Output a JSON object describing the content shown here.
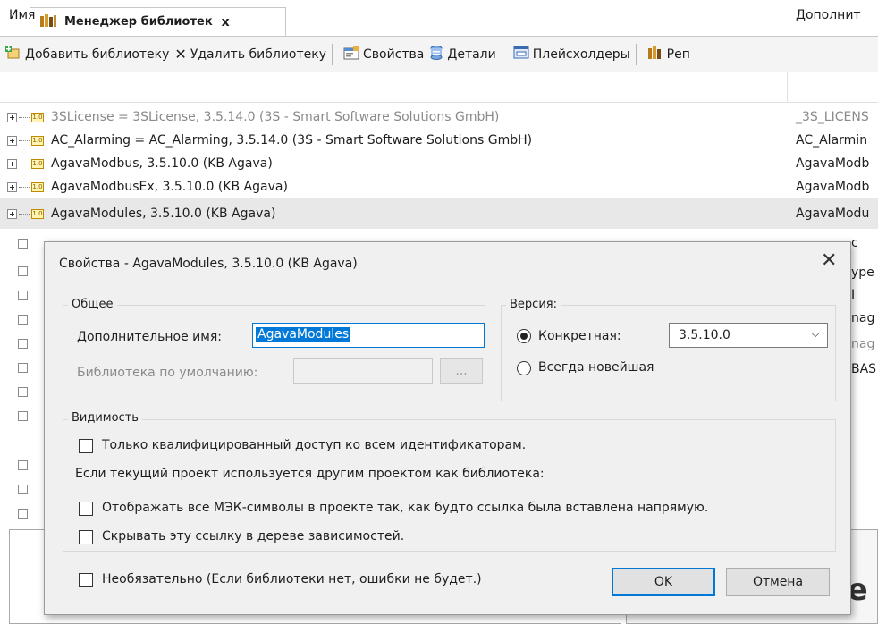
{
  "tab": {
    "title": "Менеджер библиотек",
    "close": "x"
  },
  "toolbar": {
    "add": "Добавить библиотеку",
    "delete": "Удалить библиотеку",
    "properties": "Свойства",
    "details": "Детали",
    "placeholders": "Плейсхолдеры",
    "repo": "Реп"
  },
  "list": {
    "col_name": "Имя",
    "col_additional": "Дополнит",
    "rows": [
      {
        "name": "3SLicense = 3SLicense, 3.5.14.0 (3S - Smart Software Solutions GmbH)",
        "additional": "_3S_LICENS"
      },
      {
        "name": "AC_Alarming = AC_Alarming, 3.5.14.0 (3S - Smart Software Solutions GmbH)",
        "additional": "AC_Alarmin"
      },
      {
        "name": "AgavaModbus, 3.5.10.0 (KB Agava)",
        "additional": "AgavaModb"
      },
      {
        "name": "AgavaModbusEx, 3.5.10.0 (KB Agava)",
        "additional": "AgavaModb"
      },
      {
        "name": "AgavaModules, 3.5.10.0 (KB Agava)",
        "additional": "AgavaModu"
      }
    ],
    "peek": [
      "c",
      "ype",
      "I",
      "nag",
      "nag",
      "BAS"
    ]
  },
  "background": {
    "big_text": "le"
  },
  "dialog": {
    "title": "Свойства - AgavaModules, 3.5.10.0 (KB Agava)",
    "close": "✕",
    "general": {
      "label": "Общее",
      "alias_label": "Дополнительное имя:",
      "alias_value": "AgavaModules",
      "default_label": "Библиотека по умолчанию:",
      "browse": "..."
    },
    "version": {
      "label": "Версия:",
      "specific_label": "Конкретная:",
      "specific_value": "3.5.10.0",
      "newest_label": "Всегда новейшая",
      "selected": "specific"
    },
    "visibility": {
      "label": "Видимость",
      "qualified": "Только квалифицированный доступ ко всем идентификаторам.",
      "note": "Если текущий проект используется другим проектом как библиотека:",
      "show_all": "Отображать все МЭК-символы в проекте так, как будто ссылка была вставлена напрямую.",
      "hide_ref": "Скрывать эту ссылку в дереве зависимостей."
    },
    "optional": "Необязательно (Если библиотеки нет, ошибки не будет.)",
    "ok": "OK",
    "cancel": "Отмена"
  }
}
